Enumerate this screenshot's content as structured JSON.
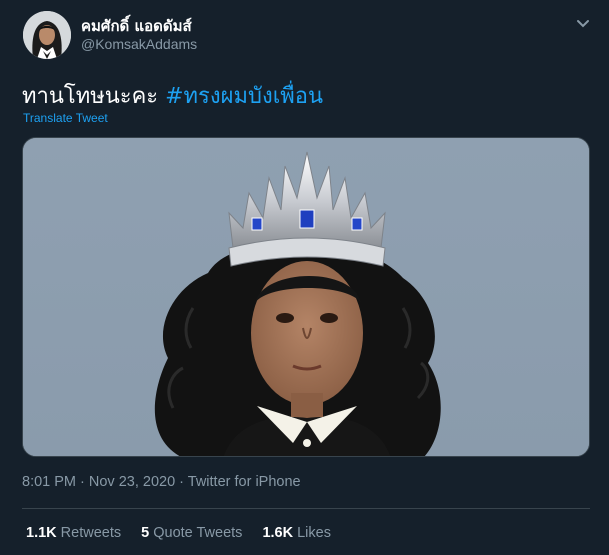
{
  "author": {
    "display_name": "คมศักดิ์ แอดดัมส์",
    "handle": "@KomsakAddams"
  },
  "tweet": {
    "text": "ทานโทษนะคะ ",
    "hashtag": "#ทรงผมบังเพื่อน",
    "translate_label": "Translate Tweet"
  },
  "meta": {
    "time": "8:01 PM",
    "separator": " · ",
    "date": "Nov 23, 2020",
    "source": "Twitter for iPhone"
  },
  "stats": {
    "retweets_count": "1.1K",
    "retweets_label": " Retweets",
    "quotes_count": "5",
    "quotes_label": " Quote Tweets",
    "likes_count": "1.6K",
    "likes_label": " Likes"
  },
  "icons": {
    "caret": "chevron-down-icon"
  },
  "colors": {
    "background": "#15202b",
    "accent": "#1da1f2",
    "muted": "#8899a6",
    "border": "#38444d"
  }
}
